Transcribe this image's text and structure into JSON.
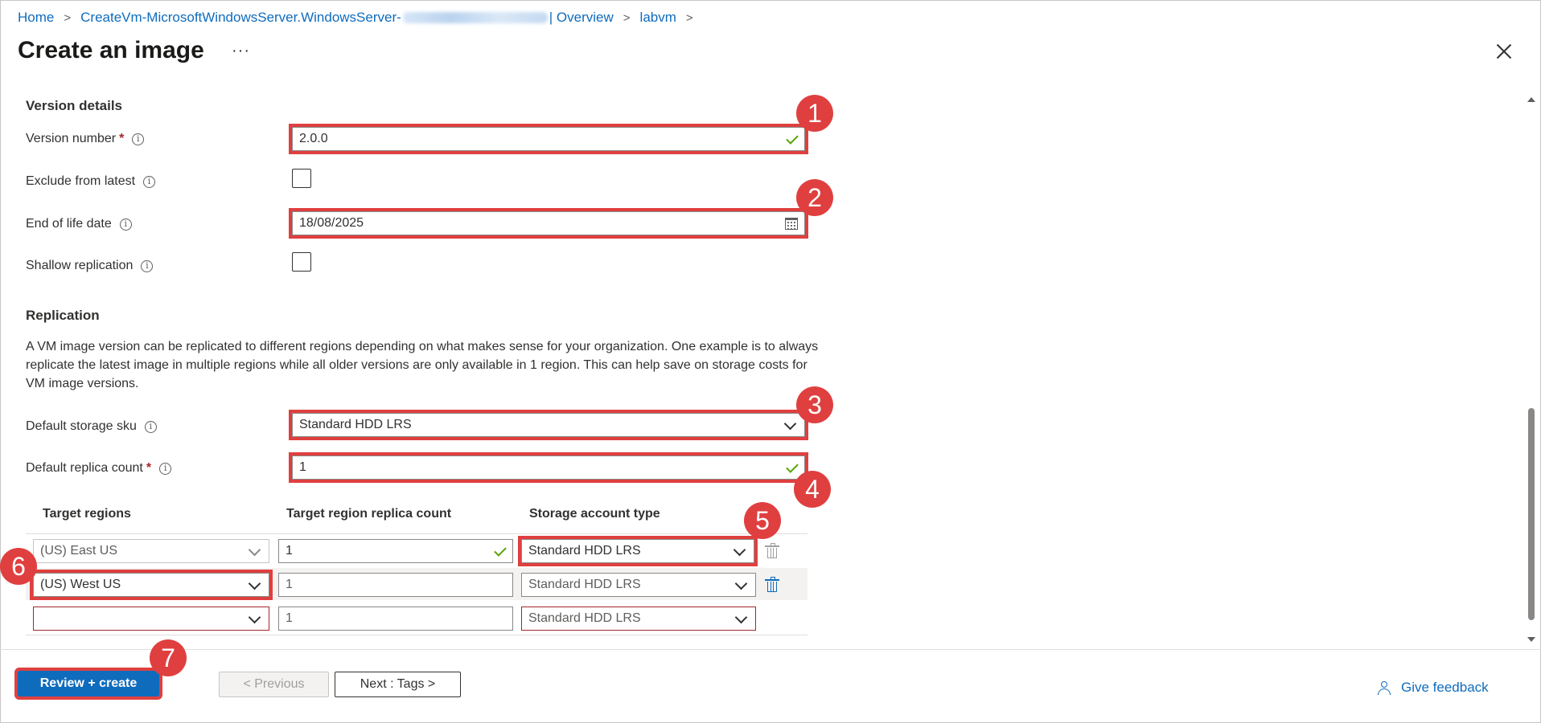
{
  "breadcrumb": {
    "home": "Home",
    "vm_create": "CreateVm-MicrosoftWindowsServer.WindowsServer-",
    "overview": "| Overview",
    "vm": "labvm"
  },
  "page": {
    "title": "Create an image",
    "more": "···"
  },
  "version_details": {
    "heading": "Version details",
    "version_number_label": "Version number",
    "version_number_value": "2.0.0",
    "exclude_label": "Exclude from latest",
    "exclude_checked": false,
    "eol_label": "End of life date",
    "eol_value": "18/08/2025",
    "shallow_label": "Shallow replication",
    "shallow_checked": false,
    "required_mark": "*"
  },
  "replication": {
    "heading": "Replication",
    "description": "A VM image version can be replicated to different regions depending on what makes sense for your organization. One example is to always replicate the latest image in multiple regions while all older versions are only available in 1 region. This can help save on storage costs for VM image versions.",
    "sku_label": "Default storage sku",
    "sku_value": "Standard HDD LRS",
    "replica_label": "Default replica count",
    "replica_value": "1"
  },
  "regions_grid": {
    "headers": [
      "Target regions",
      "Target region replica count",
      "Storage account type"
    ],
    "rows": [
      {
        "region": "(US) East US",
        "count": "1",
        "storage": "Standard HDD LRS"
      },
      {
        "region": "(US) West US",
        "count": "1",
        "storage": "Standard HDD LRS"
      },
      {
        "region": "",
        "count": "1",
        "storage": "Standard HDD LRS"
      }
    ]
  },
  "callouts": [
    "1",
    "2",
    "3",
    "4",
    "5",
    "6",
    "7"
  ],
  "footer": {
    "review_create": "Review + create",
    "previous": "< Previous",
    "next": "Next : Tags >",
    "feedback": "Give feedback"
  },
  "colors": {
    "accent": "#0f6cbd",
    "highlight": "#e03f3f",
    "valid": "#57a300",
    "required": "#a4262c"
  }
}
